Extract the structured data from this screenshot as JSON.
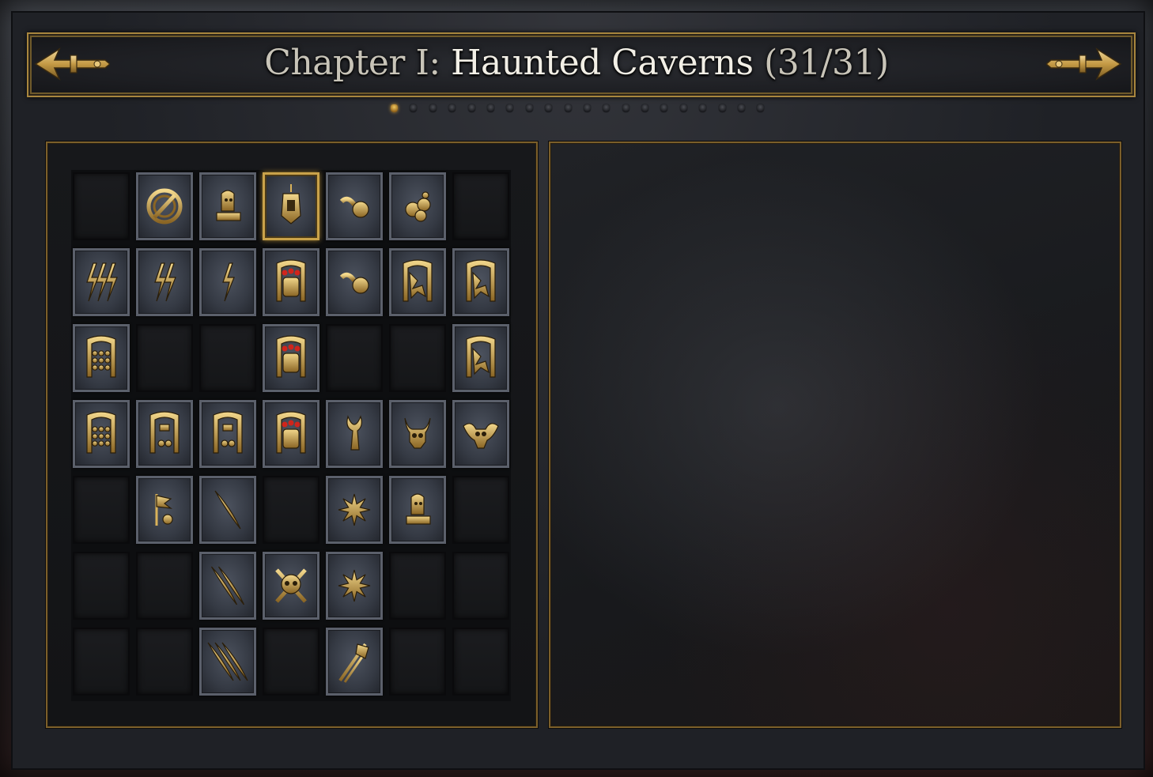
{
  "header": {
    "title_prefix": "Chapter I:",
    "title_name": "Haunted Caverns",
    "title_count": "(31/31)",
    "prev_icon": "ornate-arrow-left-icon",
    "next_icon": "ornate-arrow-right-icon"
  },
  "pager": {
    "total": 20,
    "active_index": 0
  },
  "colors": {
    "gold": "#c9a24a",
    "slot_border": "#5b606b",
    "slot_fill": "#3d424c"
  },
  "grid": {
    "cols": 7,
    "rows": 7,
    "cells": [
      [
        "",
        "no-entry-seal-icon",
        "relic-altar-icon",
        "hanging-lantern-icon",
        "coin-pair-icon",
        "coin-pile-icon",
        ""
      ],
      [
        "triple-lightning-icon",
        "double-lightning-icon",
        "single-lightning-icon",
        "red-eyed-fist-icon",
        "single-coin-icon",
        "shattered-gate-icon",
        "shattered-gate-alt-icon"
      ],
      [
        "skull-ossuary-icon",
        "",
        "",
        "red-eyed-fist-icon",
        "",
        "",
        "shattered-gate-dark-icon"
      ],
      [
        "skull-ossuary-icon",
        "skull-banner-icon",
        "skull-banner-small-icon",
        "red-eyed-fist-icon",
        "horned-idol-icon",
        "horned-skull-icon",
        "winged-skull-icon"
      ],
      [
        "",
        "banner-relic-icon",
        "single-feather-icon",
        "",
        "starburst-icon",
        "relic-altar-alt-icon",
        ""
      ],
      [
        "",
        "",
        "double-feather-icon",
        "skull-crossbones-icon",
        "spiked-star-icon",
        "",
        ""
      ],
      [
        "",
        "",
        "triple-feather-icon",
        "",
        "crossed-weapons-icon",
        "",
        ""
      ]
    ],
    "selected": [
      0,
      3
    ]
  }
}
